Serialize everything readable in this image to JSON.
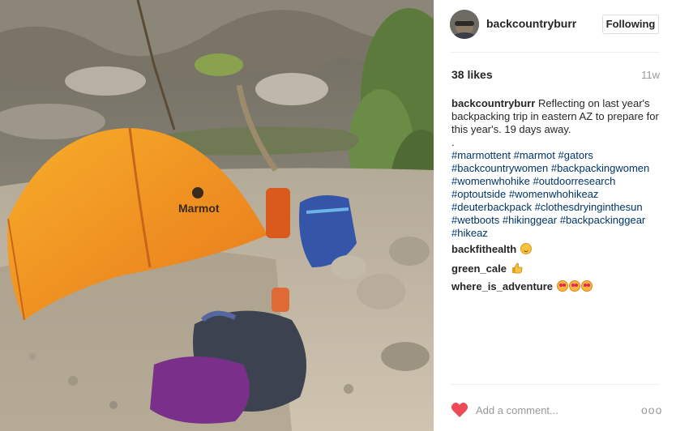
{
  "post": {
    "username": "backcountryburr",
    "follow_label": "Following",
    "likes": "38 likes",
    "time_ago": "11w",
    "caption_user": "backcountryburr",
    "caption_text": "Reflecting on last year's backpacking trip in eastern AZ to prepare for this year's. 19 days away.",
    "caption_dot": ".",
    "hashtags": [
      "#marmottent",
      "#marmot",
      "#gators",
      "#backcountrywomen",
      "#backpackingwomen",
      "#womenwhohike",
      "#outdoorresearch",
      "#optoutside",
      "#womenwhohikeaz",
      "#deuterbackpack",
      "#clothesdryinginthesun",
      "#wetboots",
      "#hikinggear",
      "#backpackinggear",
      "#hikeaz"
    ],
    "photo_logo_text": "Marmot"
  },
  "comments": [
    {
      "user": "backfithealth",
      "emoji": "smile-emoji"
    },
    {
      "user": "green_cale",
      "emoji": "thumbs-up-emoji"
    },
    {
      "user": "where_is_adventure",
      "emoji": "heart-eyes-emoji-x3"
    }
  ],
  "actions": {
    "comment_placeholder": "Add a comment...",
    "more_label": "ooo"
  },
  "colors": {
    "heart": "#ed4956",
    "hashtag": "#003569",
    "tent": "#f39a1e",
    "muted_text": "#999999"
  }
}
